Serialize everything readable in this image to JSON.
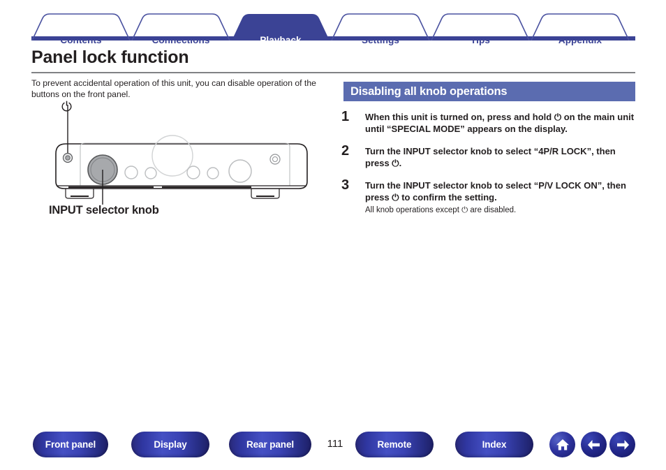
{
  "nav": {
    "tabs": [
      {
        "label": "Contents",
        "active": false
      },
      {
        "label": "Connections",
        "active": false
      },
      {
        "label": "Playback",
        "active": true
      },
      {
        "label": "Settings",
        "active": false
      },
      {
        "label": "Tips",
        "active": false
      },
      {
        "label": "Appendix",
        "active": false
      }
    ],
    "active_tab_color": "#3b4395",
    "tab_text_color": "#3b4395",
    "active_tab_text_color": "#ffffff"
  },
  "page": {
    "title": "Panel lock function",
    "intro": "To prevent accidental operation of this unit, you can disable operation of the buttons on the front panel."
  },
  "illustration": {
    "power_symbol": "⏻",
    "caption": "INPUT selector knob"
  },
  "section": {
    "heading": "Disabling all knob operations",
    "heading_bg": "#5b6cb0",
    "steps": [
      {
        "number": "1",
        "text": "When this unit is turned on, press and hold ⏻ on the main unit until “SPECIAL MODE” appears on the display.",
        "note": ""
      },
      {
        "number": "2",
        "text": "Turn the INPUT selector knob to select “4P/R LOCK”, then press ⏻.",
        "note": ""
      },
      {
        "number": "3",
        "text": "Turn the INPUT selector knob to select “P/V LOCK ON”, then press ⏻ to confirm the setting.",
        "note": "All knob operations except ⏻ are disabled."
      }
    ]
  },
  "footer": {
    "buttons": [
      {
        "label": "Front panel"
      },
      {
        "label": "Display"
      },
      {
        "label": "Rear panel"
      },
      {
        "label": "Remote"
      },
      {
        "label": "Index"
      }
    ],
    "page_number": "111",
    "icons": [
      {
        "name": "home-icon"
      },
      {
        "name": "arrow-left-icon"
      },
      {
        "name": "arrow-right-icon"
      }
    ],
    "button_color": "#2f36a0"
  }
}
